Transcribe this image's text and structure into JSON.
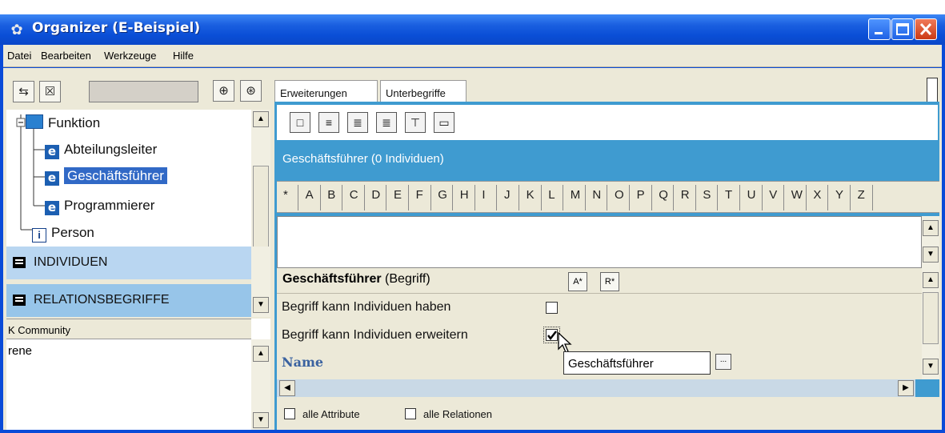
{
  "window": {
    "title": "Organizer (E-Beispiel)"
  },
  "menu": [
    "Datei",
    "Bearbeiten",
    "Werkzeuge",
    "Hilfe"
  ],
  "tree": {
    "root": "Funktion",
    "children": [
      "Abteilungsleiter",
      "Geschäftsführer",
      "Programmierer"
    ],
    "sibling": "Person",
    "selected": "Geschäftsführer"
  },
  "sections": {
    "individuals": "INDIVIDUEN",
    "relations": "RELATIONSBEGRIFFE"
  },
  "community": {
    "label": "K Community",
    "item": "rene"
  },
  "tabs": [
    "Erweiterungen",
    "Unterbegriffe"
  ],
  "concept_header": "Geschäftsführer (0 Individuen)",
  "alphabet": [
    "*",
    "A",
    "B",
    "C",
    "D",
    "E",
    "F",
    "G",
    "H",
    "I",
    "J",
    "K",
    "L",
    "M",
    "N",
    "O",
    "P",
    "Q",
    "R",
    "S",
    "T",
    "U",
    "V",
    "W",
    "X",
    "Y",
    "Z"
  ],
  "detail": {
    "title_bold": "Geschäftsführer",
    "title_rest": " (Begriff)",
    "props": [
      {
        "label": "Begriff kann Individuen haben",
        "checked": false
      },
      {
        "label": "Begriff kann Individuen erweitern",
        "checked": true
      }
    ],
    "name_label": "Name",
    "tooltip": "Geschäftsführer",
    "btn_a": "A*",
    "btn_r": "R*",
    "ellipsis": "..."
  },
  "bottom": {
    "all_attributes": "alle Attribute",
    "all_relations": "alle Relationen"
  },
  "icons": {
    "app": "organizer-icon",
    "window_controls": [
      "minimize-icon",
      "maximize-icon",
      "close-icon"
    ]
  }
}
